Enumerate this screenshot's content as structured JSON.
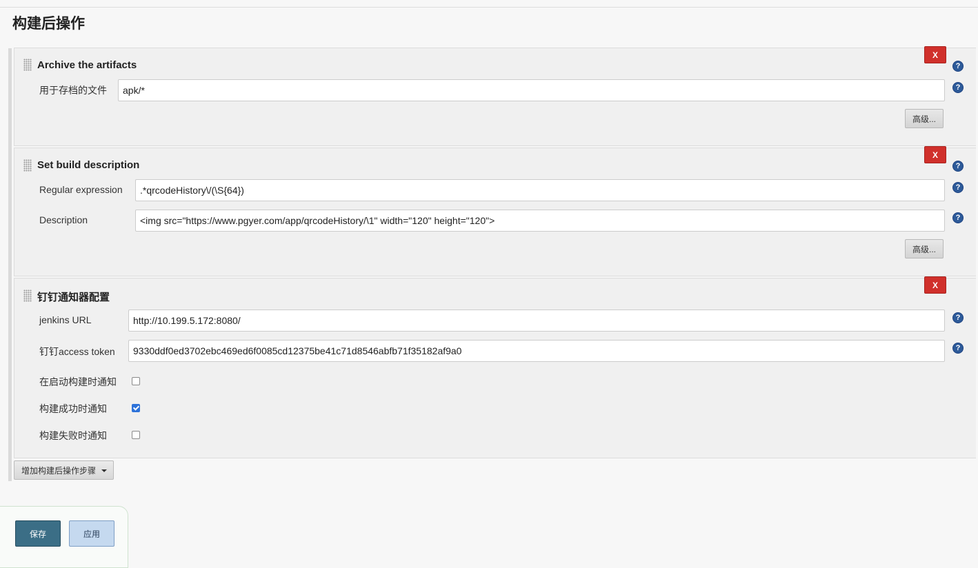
{
  "section": {
    "title": "构建后操作"
  },
  "archive": {
    "title": "Archive the artifacts",
    "close_label": "X",
    "files_label": "用于存档的文件",
    "files_value": "apk/*",
    "advanced_label": "高级..."
  },
  "build_description": {
    "title": "Set build description",
    "close_label": "X",
    "regex_label": "Regular expression",
    "regex_value": ".*qrcodeHistory\\/(\\S{64})",
    "description_label": "Description",
    "description_value": "<img src=\"https://www.pgyer.com/app/qrcodeHistory/\\1\" width=\"120\" height=\"120\">",
    "advanced_label": "高级..."
  },
  "dingtalk": {
    "title": "钉钉通知器配置",
    "close_label": "X",
    "jenkins_url_label": "jenkins URL",
    "jenkins_url_value": "http://10.199.5.172:8080/",
    "token_label": "钉钉access token",
    "token_value": "9330ddf0ed3702ebc469ed6f0085cd12375be41c71d8546abfb71f35182af9a0",
    "notify_on_start_label": "在启动构建时通知",
    "notify_on_start_checked": false,
    "notify_on_success_label": "构建成功时通知",
    "notify_on_success_checked": true,
    "notify_on_failure_label": "构建失败时通知",
    "notify_on_failure_checked": false
  },
  "help": {
    "glyph": "?"
  },
  "add_step": {
    "label": "增加构建后操作步骤"
  },
  "footer": {
    "save_label": "保存",
    "apply_label": "应用"
  },
  "colors": {
    "danger": "#d0302b",
    "help": "#2d5a99",
    "save": "#3b6e86",
    "apply": "#c5d9ef",
    "checkbox_checked": "#2d72d9"
  },
  "icons": {
    "drag": "drag-handle-icon",
    "help": "help-icon",
    "close": "close-icon",
    "caret": "caret-down-icon",
    "check": "checkmark-icon"
  }
}
